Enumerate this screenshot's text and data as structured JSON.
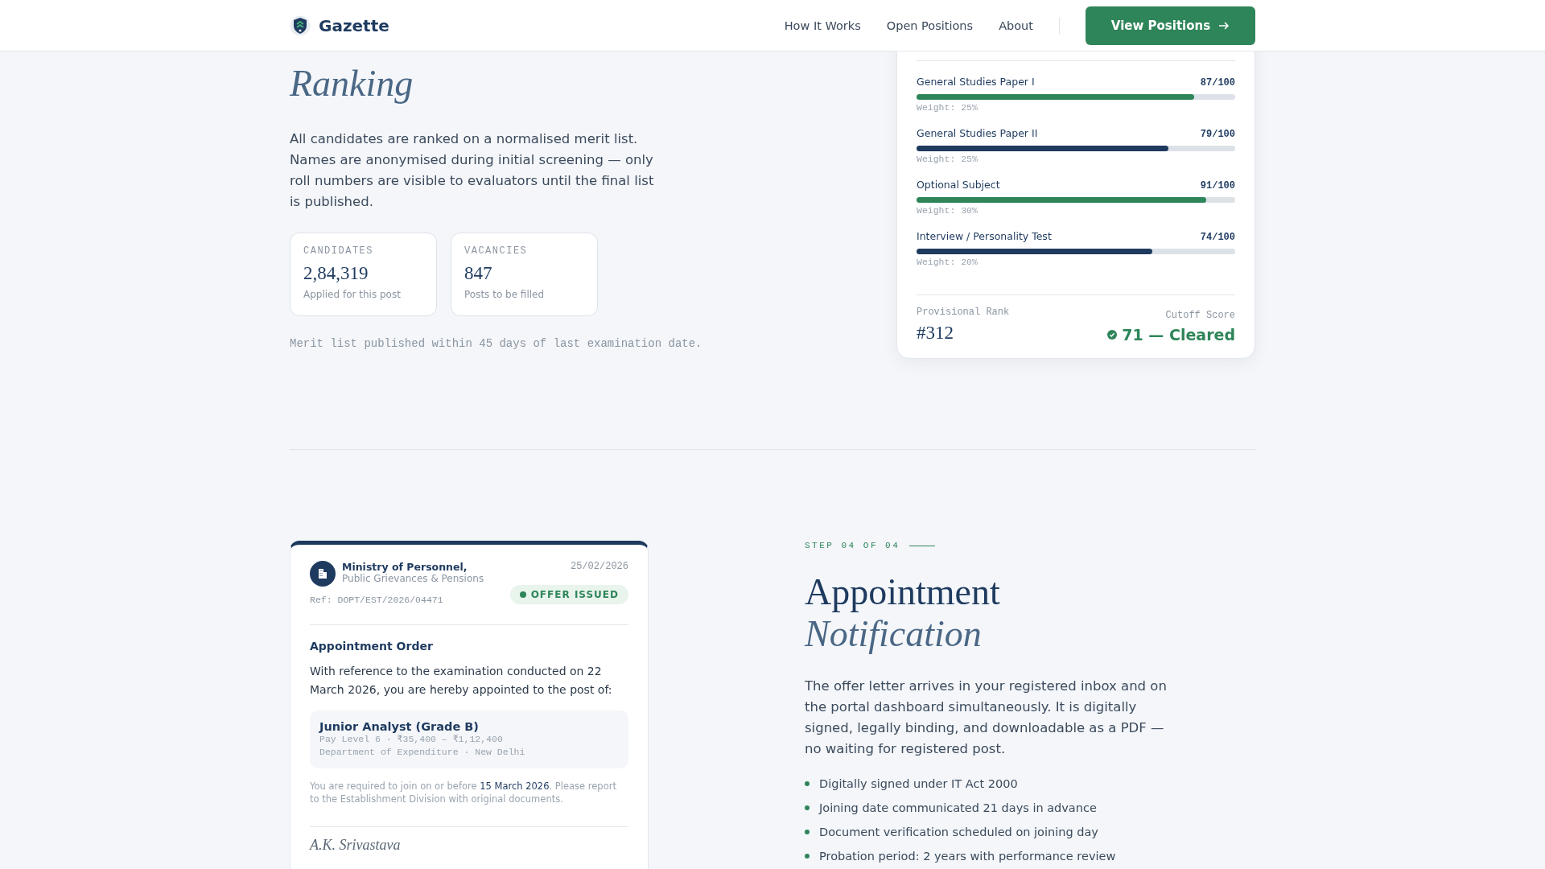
{
  "header": {
    "brand": "Gazette",
    "nav": [
      "How It Works",
      "Open Positions",
      "About"
    ],
    "cta": "View Positions"
  },
  "ranking": {
    "title": "Ranking",
    "body": "All candidates are ranked on a normalised merit list. Names are anonymised during initial screening — only roll numbers are visible to evaluators until the final list is published.",
    "stats": [
      {
        "label": "CANDIDATES",
        "value": "2,84,319",
        "caption": "Applied for this post"
      },
      {
        "label": "VACANCIES",
        "value": "847",
        "caption": "Posts to be filled"
      }
    ],
    "note": "Merit list published within 45 days of last examination date."
  },
  "scorecard": {
    "subjects": [
      {
        "name": "General Studies Paper I",
        "score": "87/100",
        "level": 0.87,
        "color": "#2f855a",
        "weight": "Weight: 25%"
      },
      {
        "name": "General Studies Paper II",
        "score": "79/100",
        "level": 0.79,
        "color": "#1e3a5f",
        "weight": "Weight: 25%"
      },
      {
        "name": "Optional Subject",
        "score": "91/100",
        "level": 0.91,
        "color": "#2f855a",
        "weight": "Weight: 30%"
      },
      {
        "name": "Interview / Personality Test",
        "score": "74/100",
        "level": 0.74,
        "color": "#1e3a5f",
        "weight": "Weight: 20%"
      }
    ],
    "rank_label": "Provisional Rank",
    "rank": "#312",
    "cutoff_label": "Cutoff Score",
    "cutoff": "71 — Cleared"
  },
  "letter": {
    "org": "Ministry of Personnel,",
    "org_sub": "Public Grievances & Pensions",
    "ref": "Ref: DOPT/EST/2026/04471",
    "date": "25/02/2026",
    "badge": "OFFER ISSUED",
    "title": "Appointment Order",
    "body": "With reference to the examination conducted on 22 March 2026, you are hereby appointed to the post of:",
    "post": "Junior Analyst (Grade B)",
    "post_lines": [
      "Pay Level 6 · ₹35,400 – ₹1,12,400",
      "Department of Expenditure · New Delhi"
    ],
    "note": "You are required to join on or before **15 March 2026**. Please report to the Establishment Division with original documents.",
    "signature": "A.K. Srivastava"
  },
  "step": {
    "label": "STEP 04 OF 04",
    "title_lines": [
      "Appointment",
      "Notification"
    ],
    "body": "The offer letter arrives in your registered inbox and on the portal dashboard simultaneously. It is digitally signed, legally binding, and downloadable as a PDF — no waiting for registered post.",
    "bullets": [
      "Digitally signed under IT Act 2000",
      "Joining date communicated 21 days in advance",
      "Document verification scheduled on joining day",
      "Probation period: 2 years with performance review"
    ]
  }
}
